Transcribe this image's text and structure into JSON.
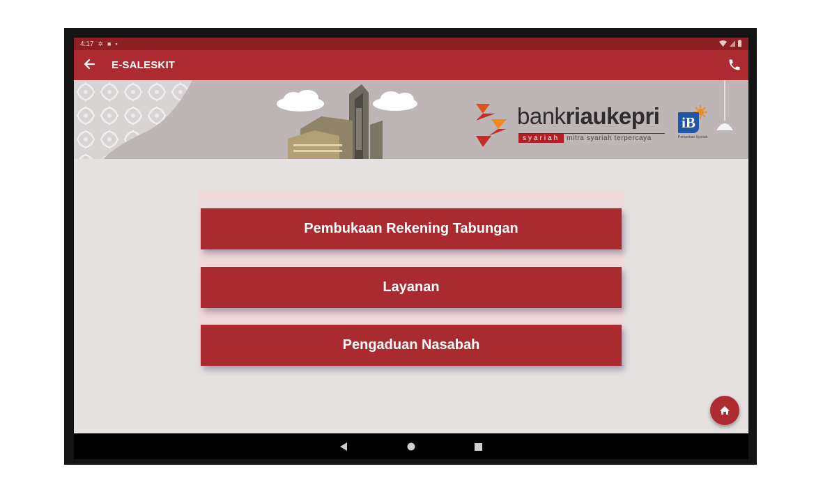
{
  "status_bar": {
    "time": "4:17"
  },
  "app_bar": {
    "title": "E-SALESKIT"
  },
  "banner": {
    "brand_word_light": "bank",
    "brand_word_bold": "riaukepri",
    "brand_badge": "syariah",
    "tagline": "mitra syariah terpercaya",
    "ib_mark": "iB",
    "ib_caption": "Perbankan Syariah"
  },
  "menu": {
    "items": [
      {
        "label": "Pembukaan Rekening Tabungan"
      },
      {
        "label": "Layanan"
      },
      {
        "label": "Pengaduan Nasabah"
      }
    ]
  },
  "colors": {
    "brand_red": "#ac2b30",
    "status_red": "#8c2023",
    "button_red": "#aa2b2f",
    "background": "#e5e1e1",
    "logo_orange": "#f08a1c"
  },
  "icons": {
    "back": "arrow-left-icon",
    "call": "phone-icon",
    "home": "home-icon",
    "nav_back": "triangle-back-icon",
    "nav_home": "circle-home-icon",
    "nav_recents": "square-recents-icon"
  }
}
